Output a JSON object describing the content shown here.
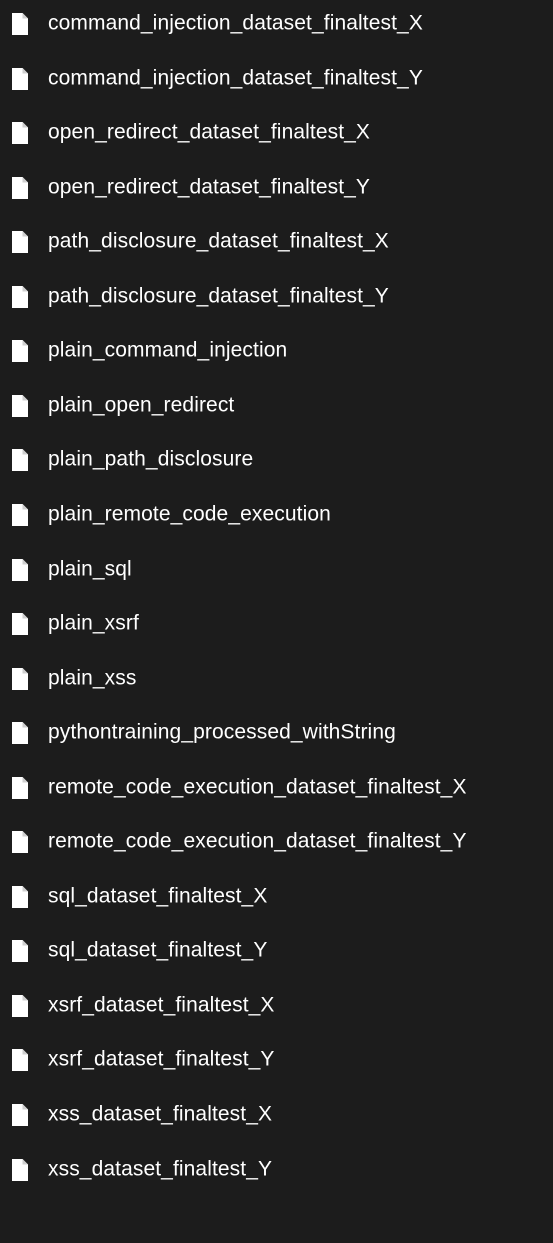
{
  "files": [
    {
      "name": "command_injection_dataset_finaltest_X",
      "icon": "file-icon"
    },
    {
      "name": "command_injection_dataset_finaltest_Y",
      "icon": "file-icon"
    },
    {
      "name": "open_redirect_dataset_finaltest_X",
      "icon": "file-icon"
    },
    {
      "name": "open_redirect_dataset_finaltest_Y",
      "icon": "file-icon"
    },
    {
      "name": "path_disclosure_dataset_finaltest_X",
      "icon": "file-icon"
    },
    {
      "name": "path_disclosure_dataset_finaltest_Y",
      "icon": "file-icon"
    },
    {
      "name": "plain_command_injection",
      "icon": "file-icon"
    },
    {
      "name": "plain_open_redirect",
      "icon": "file-icon"
    },
    {
      "name": "plain_path_disclosure",
      "icon": "file-icon"
    },
    {
      "name": "plain_remote_code_execution",
      "icon": "file-icon"
    },
    {
      "name": "plain_sql",
      "icon": "file-icon"
    },
    {
      "name": "plain_xsrf",
      "icon": "file-icon"
    },
    {
      "name": "plain_xss",
      "icon": "file-icon"
    },
    {
      "name": "pythontraining_processed_withString",
      "icon": "file-icon"
    },
    {
      "name": "remote_code_execution_dataset_finaltest_X",
      "icon": "file-icon"
    },
    {
      "name": "remote_code_execution_dataset_finaltest_Y",
      "icon": "file-icon"
    },
    {
      "name": "sql_dataset_finaltest_X",
      "icon": "file-icon"
    },
    {
      "name": "sql_dataset_finaltest_Y",
      "icon": "file-icon"
    },
    {
      "name": "xsrf_dataset_finaltest_X",
      "icon": "file-icon"
    },
    {
      "name": "xsrf_dataset_finaltest_Y",
      "icon": "file-icon"
    },
    {
      "name": "xss_dataset_finaltest_X",
      "icon": "file-icon"
    },
    {
      "name": "xss_dataset_finaltest_Y",
      "icon": "file-icon"
    }
  ],
  "colors": {
    "background": "#1c1c1c",
    "text": "#ffffff",
    "icon": "#ffffff"
  }
}
